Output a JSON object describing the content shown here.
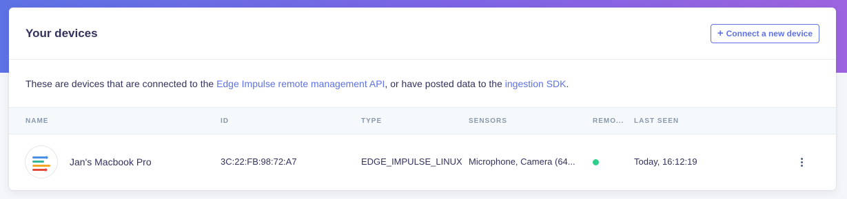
{
  "header": {
    "title": "Your devices",
    "connect_label": "Connect a new device",
    "connect_icon": "plus-icon"
  },
  "description": {
    "before": "These are devices that are connected to the ",
    "link1": "Edge Impulse remote management API",
    "middle": ", or have posted data to the ",
    "link2": "ingestion SDK",
    "after": "."
  },
  "table": {
    "columns": [
      "NAME",
      "ID",
      "TYPE",
      "SENSORS",
      "REMO...",
      "LAST SEEN"
    ],
    "rows": [
      {
        "name": "Jan's Macbook Pro",
        "id": "3C:22:FB:98:72:A7",
        "type": "EDGE_IMPULSE_LINUX",
        "sensors": "Microphone, Camera (64...",
        "remote_status": "connected",
        "last_seen": "Today, 16:12:19",
        "avatar_icon": "edge-impulse-logo-icon",
        "menu_icon": "more-vertical-icon"
      }
    ]
  },
  "colors": {
    "accent": "#5e72e4",
    "status_online": "#2dce89",
    "gradient_start": "#5d72e4",
    "gradient_end": "#9d63de"
  }
}
